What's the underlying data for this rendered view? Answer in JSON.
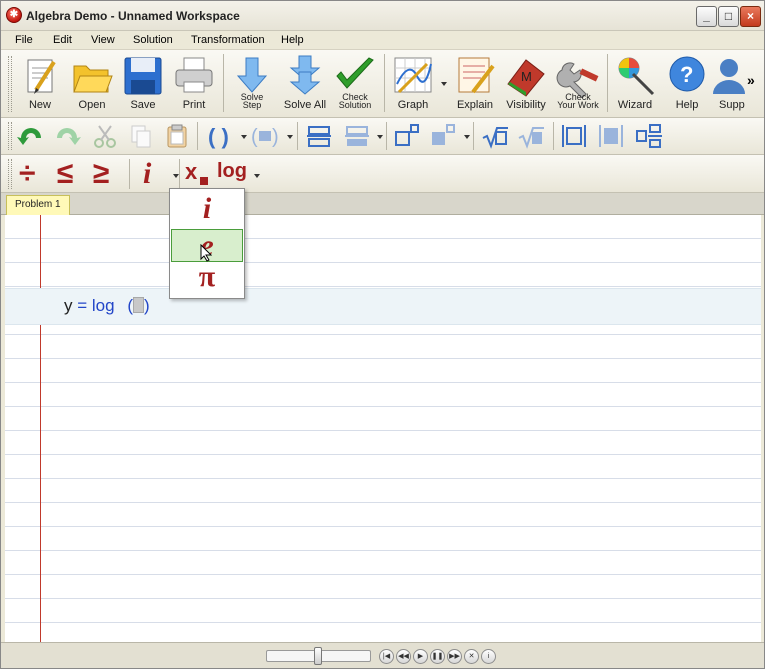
{
  "window": {
    "title": "Algebra Demo - Unnamed Workspace",
    "minimize_glyph": "_",
    "maximize_glyph": "□",
    "close_glyph": "×"
  },
  "menu": [
    "File",
    "Edit",
    "View",
    "Solution",
    "Transformation",
    "Help"
  ],
  "toolbar_main": {
    "new": "New",
    "open": "Open",
    "save": "Save",
    "print": "Print",
    "solve_step_1": "Solve",
    "solve_step_2": "Step",
    "solve_all": "Solve All",
    "check_solution_1": "Check",
    "check_solution_2": "Solution",
    "graph": "Graph",
    "explain": "Explain",
    "visibility": "Visibility",
    "check_work_1": "Check",
    "check_work_2": "Your Work",
    "wizard": "Wizard",
    "help": "Help",
    "support": "Supp",
    "overflow": "»"
  },
  "toolbar_math": {
    "divide": "÷",
    "less_equal": "≤",
    "greater_equal": "≥",
    "imaginary": "i",
    "subscript": "x",
    "log": "log"
  },
  "tabs": {
    "problem_1": "Problem 1"
  },
  "equation": {
    "lhs": "y",
    "equals": "=",
    "func": "log",
    "open_paren": "(",
    "close_paren": ")"
  },
  "dropdown": {
    "items": [
      "i",
      "e",
      "π"
    ],
    "selected_index": 1
  },
  "colors": {
    "accent_red": "#a32020",
    "equation_blue": "#2346c8",
    "selected_green": "#d8eecd"
  }
}
